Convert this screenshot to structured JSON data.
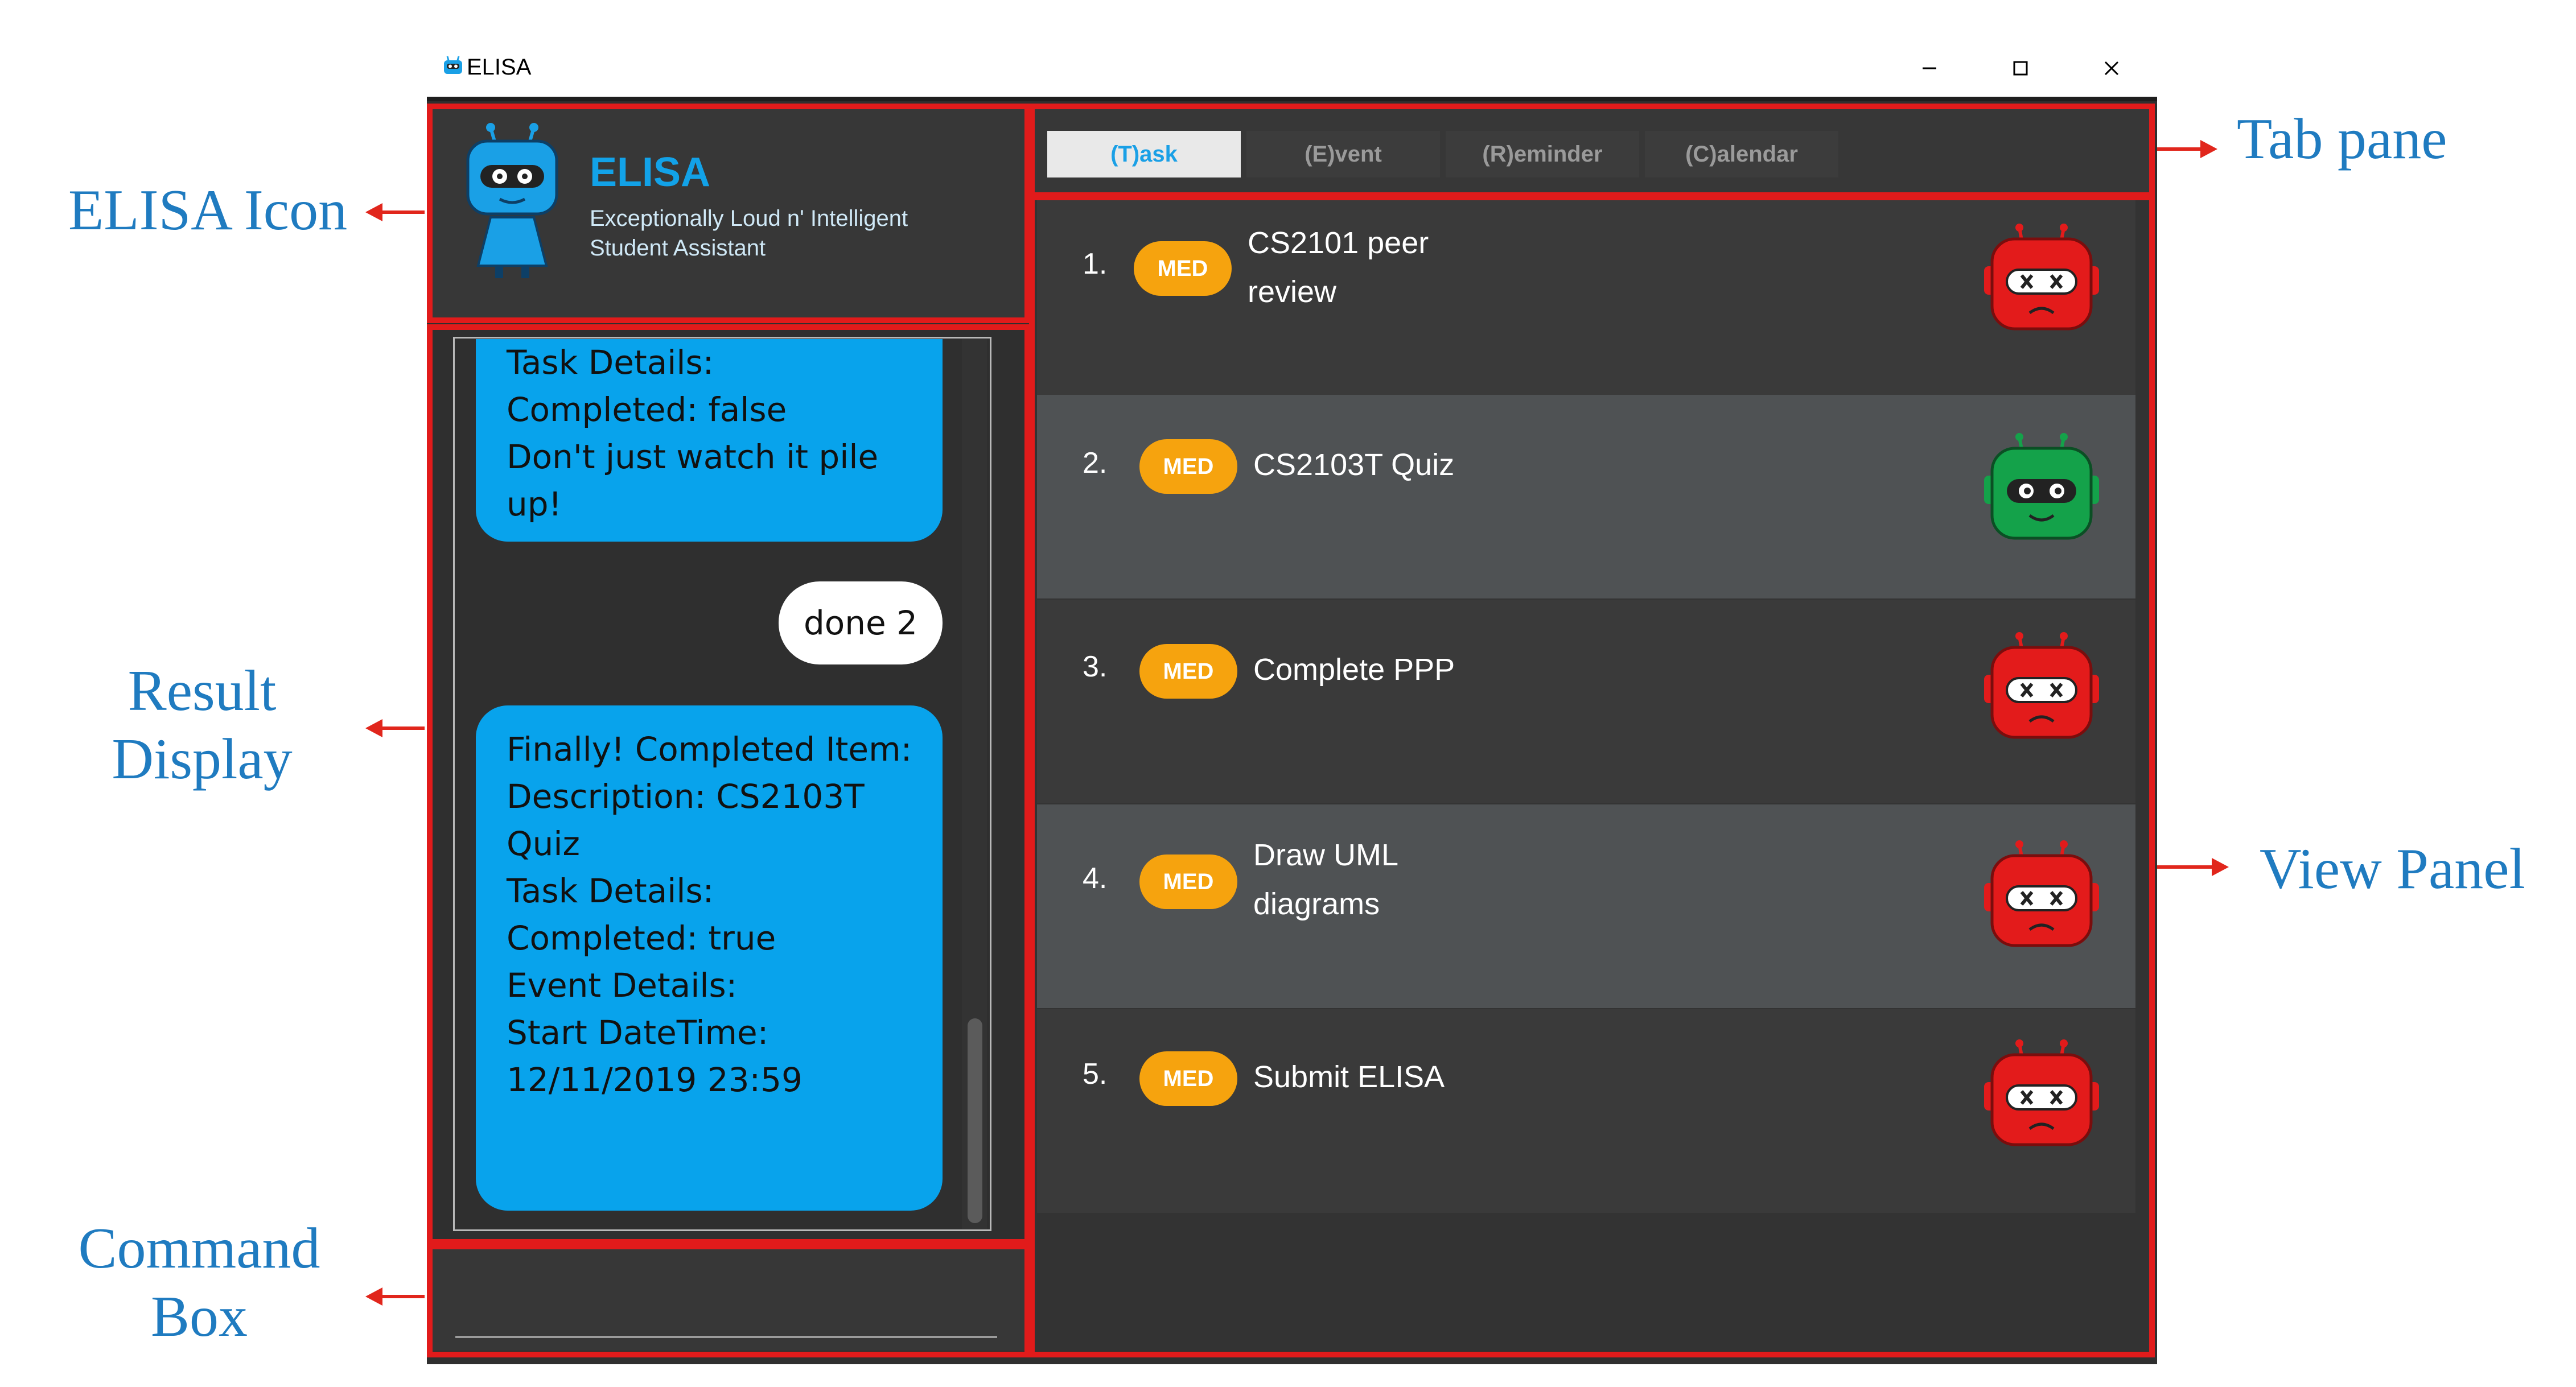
{
  "annotations": {
    "elisa_icon": "ELISA Icon",
    "result_display": [
      "Result",
      "Display"
    ],
    "command_box": [
      "Command",
      "Box"
    ],
    "tab_pane": "Tab pane",
    "view_panel": "View Panel"
  },
  "window": {
    "title": "ELISA",
    "controls": [
      "minimize",
      "maximize",
      "close"
    ]
  },
  "header": {
    "app_name": "ELISA",
    "subtitle_line1": "Exceptionally Loud n' Intelligent",
    "subtitle_line2": "Student Assistant"
  },
  "chat": {
    "bubble1": [
      "Task Details:",
      "Completed: false",
      "Don't just watch it pile",
      "up!"
    ],
    "user_message": "done 2",
    "bubble2": [
      "Finally! Completed Item:",
      "Description: CS2103T",
      "Quiz",
      "",
      "Task Details:",
      "Completed: true",
      "",
      "Event Details:",
      "Start DateTime:",
      "12/11/2019 23:59"
    ]
  },
  "command_box": {
    "value": ""
  },
  "tabs": [
    "(T)ask",
    "(E)vent",
    "(R)eminder",
    "(C)alendar"
  ],
  "active_tab": "(T)ask",
  "tasks": [
    {
      "num": "1.",
      "priority": "MED",
      "desc_line1": "CS2101 peer",
      "desc_line2": "review",
      "status_icon": "red-robot-not-done-icon"
    },
    {
      "num": "2.",
      "priority": "MED",
      "desc_line1": "CS2103T Quiz",
      "desc_line2": "",
      "status_icon": "green-robot-done-icon"
    },
    {
      "num": "3.",
      "priority": "MED",
      "desc_line1": "Complete PPP",
      "desc_line2": "",
      "status_icon": "red-robot-not-done-icon"
    },
    {
      "num": "4.",
      "priority": "MED",
      "desc_line1": "Draw UML",
      "desc_line2": "diagrams",
      "status_icon": "red-robot-not-done-icon"
    },
    {
      "num": "5.",
      "priority": "MED",
      "desc_line1": "Submit ELISA",
      "desc_line2": "",
      "status_icon": "red-robot-not-done-icon"
    }
  ],
  "colors": {
    "annotation_blue": "#1f7bc0",
    "highlight_red": "#e11b1b",
    "chat_blue": "#08a3ec",
    "badge_orange": "#f6a30e",
    "robot_red": "#e31b1b",
    "robot_green": "#14a24a"
  }
}
